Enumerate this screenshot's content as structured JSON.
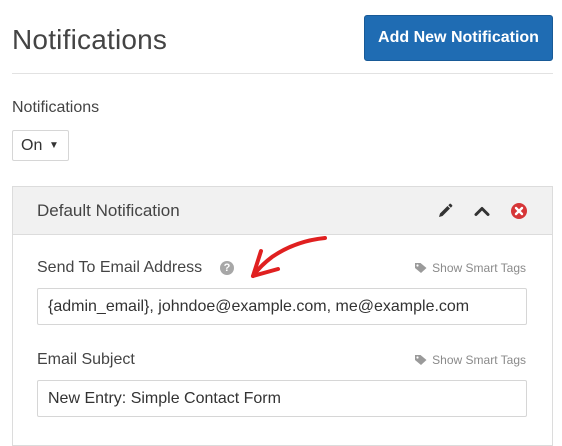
{
  "header": {
    "title": "Notifications",
    "add_button_label": "Add New Notification"
  },
  "notifications_toggle": {
    "label": "Notifications",
    "selected": "On"
  },
  "notification_panel": {
    "title": "Default Notification",
    "icons": [
      "pencil-icon",
      "chevron-up-icon",
      "close-circle-icon"
    ],
    "fields": [
      {
        "label": "Send To Email Address",
        "value": "{admin_email}, johndoe@example.com, me@example.com",
        "smart_tags_label": "Show Smart Tags"
      },
      {
        "label": "Email Subject",
        "value": "New Entry: Simple Contact Form",
        "smart_tags_label": "Show Smart Tags"
      }
    ]
  },
  "colors": {
    "primary_button": "#1f6cb3",
    "delete_icon": "#d63638",
    "annotation_arrow": "#e02020"
  }
}
